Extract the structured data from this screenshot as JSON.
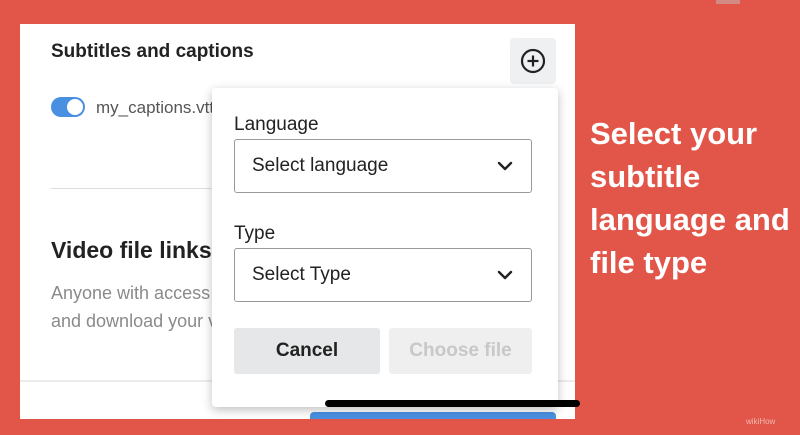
{
  "panel": {
    "title": "Subtitles and captions",
    "caption_file": "my_captions.vtt",
    "caption_enabled": true,
    "video_links_title": "Video file links",
    "video_links_desc_line1": "Anyone with access to this video can view",
    "video_links_desc_line2": "and download your video file"
  },
  "popover": {
    "language_label": "Language",
    "language_value": "Select language",
    "type_label": "Type",
    "type_value": "Select Type",
    "cancel_label": "Cancel",
    "choose_file_label": "Choose file"
  },
  "promo": {
    "line1": "Select your",
    "line2": "subtitle",
    "line3": "language and",
    "line4": "file type"
  },
  "watermark": "wikiHow",
  "colors": {
    "background": "#e2564a",
    "toggle": "#4a90e2",
    "disabled_text": "#c8c8c8"
  },
  "icons": {
    "add": "plus-circle-icon",
    "dropdown": "chevron-down-icon"
  }
}
